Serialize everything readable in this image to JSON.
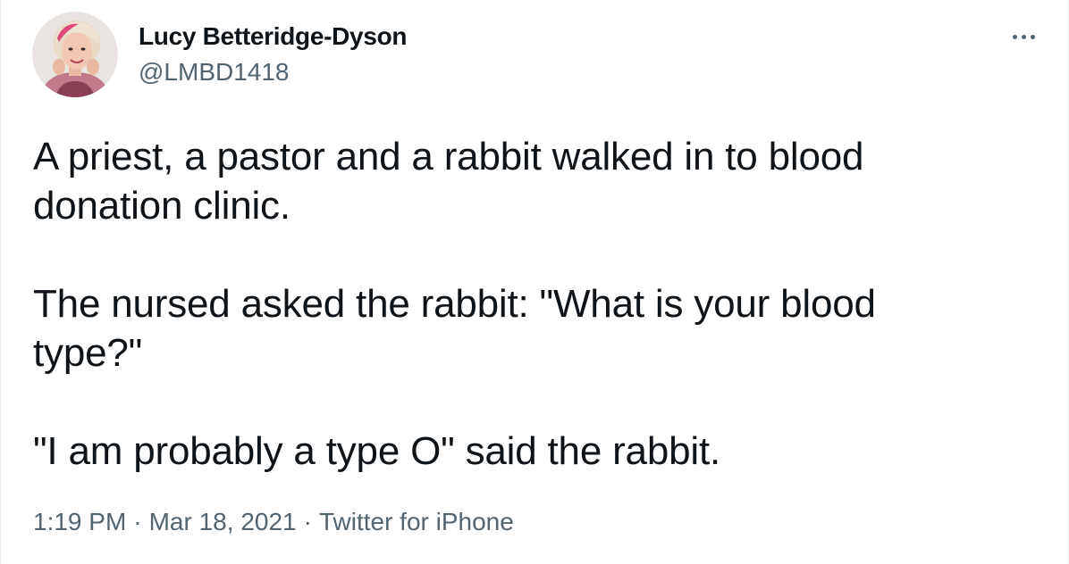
{
  "author": {
    "name": "Lucy Betteridge-Dyson",
    "handle": "@LMBD1418"
  },
  "tweet": {
    "paragraphs": [
      "A priest, a pastor and a rabbit walked in to blood\ndonation clinic.",
      "The nursed asked the rabbit: \"What is your blood\ntype?\"",
      "\"I am probably a type O\" said the rabbit."
    ]
  },
  "meta": {
    "time": "1:19 PM",
    "date": "Mar 18, 2021",
    "source": "Twitter for iPhone",
    "separator": "·"
  },
  "icons": {
    "more": "more-horizontal-icon"
  },
  "colors": {
    "text_primary": "#0f1419",
    "text_secondary": "#536471",
    "background": "#ffffff"
  }
}
